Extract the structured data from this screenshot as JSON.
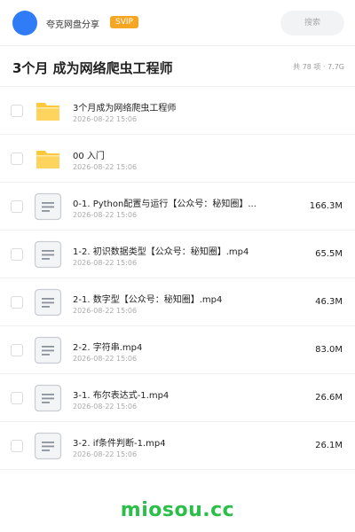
{
  "header": {
    "share_name": "夸克网盘分享",
    "vip_badge": "SVIP",
    "search_placeholder": "搜索"
  },
  "folder": {
    "title": "3个月 成为网络爬虫工程师",
    "meta": "共 78 项 · 7.7G"
  },
  "files": [
    {
      "type": "folder",
      "icon": "folder-icon",
      "name": "3个月成为网络爬虫工程师",
      "date": "2026-08-22 15:06",
      "size": ""
    },
    {
      "type": "folder",
      "icon": "folder-icon",
      "name": "00 入门",
      "date": "2026-08-22 15:06",
      "size": ""
    },
    {
      "type": "file",
      "icon": "document-icon",
      "name": "0-1. Python配置与运行【公众号：秘知圈】...",
      "date": "2026-08-22 15:06",
      "size": "166.3M"
    },
    {
      "type": "file",
      "icon": "document-icon",
      "name": "1-2. 初识数据类型【公众号：秘知圈】.mp4",
      "date": "2026-08-22 15:06",
      "size": "65.5M"
    },
    {
      "type": "file",
      "icon": "document-icon",
      "name": "2-1. 数字型【公众号：秘知圈】.mp4",
      "date": "2026-08-22 15:06",
      "size": "46.3M"
    },
    {
      "type": "file",
      "icon": "document-icon",
      "name": "2-2. 字符串.mp4",
      "date": "2026-08-22 15:06",
      "size": "83.0M"
    },
    {
      "type": "file",
      "icon": "document-icon",
      "name": "3-1. 布尔表达式-1.mp4",
      "date": "2026-08-22 15:06",
      "size": "26.6M"
    },
    {
      "type": "file",
      "icon": "document-icon",
      "name": "3-2. if条件判断-1.mp4",
      "date": "2026-08-22 15:06",
      "size": "26.1M"
    }
  ],
  "watermark": "miosou.cc",
  "colors": {
    "avatar": "#2f7cf6",
    "vip": "#f5a623",
    "folder": "#ffc83d",
    "watermark": "#2bbf4a"
  }
}
